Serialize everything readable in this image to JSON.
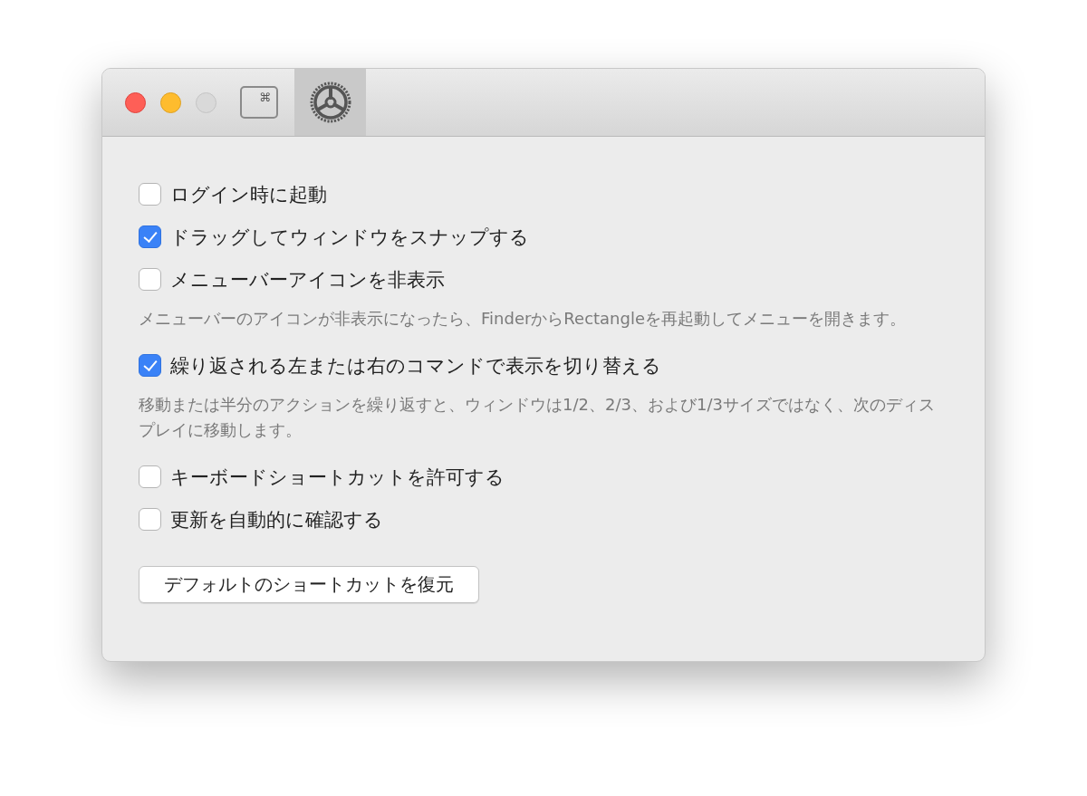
{
  "toolbar": {
    "tabs": [
      {
        "kind": "keyboard",
        "label": "⌘",
        "selected": false
      },
      {
        "kind": "general",
        "selected": true
      }
    ]
  },
  "settings": [
    {
      "kind": "checkbox",
      "label": "ログイン時に起動",
      "checked": false
    },
    {
      "kind": "checkbox",
      "label": "ドラッグしてウィンドウをスナップする",
      "checked": true
    },
    {
      "kind": "checkbox",
      "label": "メニューバーアイコンを非表示",
      "checked": false
    },
    {
      "kind": "note",
      "text": "メニューバーのアイコンが非表示になったら、FinderからRectangleを再起動してメニューを開きます。"
    },
    {
      "kind": "checkbox",
      "label": "繰り返される左または右のコマンドで表示を切り替える",
      "checked": true
    },
    {
      "kind": "note",
      "text": "移動または半分のアクションを繰り返すと、ウィンドウは1/2、2/3、および1/3サイズではなく、次のディスプレイに移動します。"
    },
    {
      "kind": "checkbox",
      "label": "キーボードショートカットを許可する",
      "checked": false
    },
    {
      "kind": "checkbox",
      "label": "更新を自動的に確認する",
      "checked": false
    }
  ],
  "restore_button": "デフォルトのショートカットを復元"
}
